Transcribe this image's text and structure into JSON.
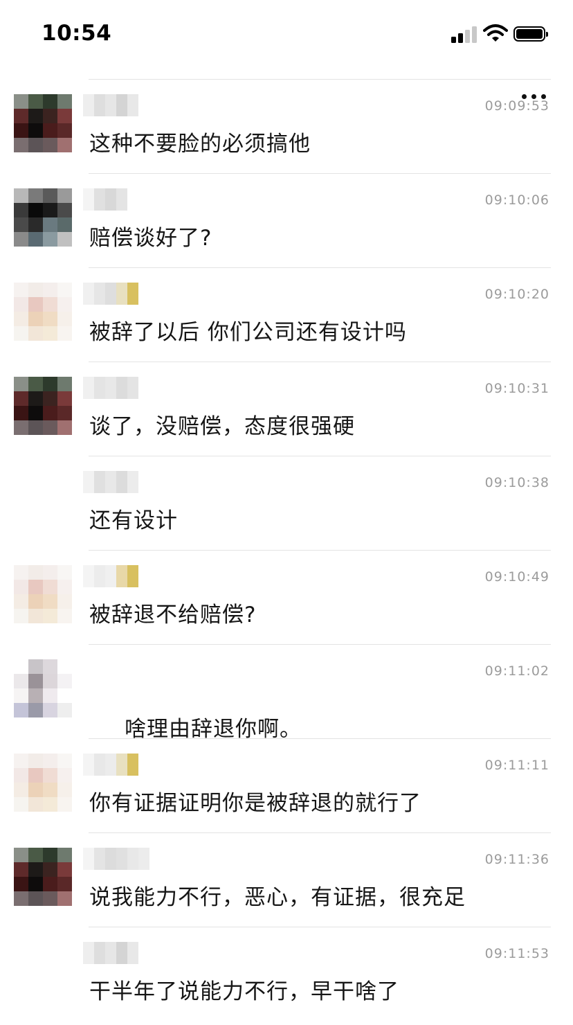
{
  "status": {
    "time": "10:54"
  },
  "icons": {
    "more": "more-dots-icon",
    "signal": "cellular-signal-icon",
    "wifi": "wifi-icon",
    "battery": "battery-icon"
  },
  "messages": [
    {
      "time": "09:09:53",
      "text": "这种不要脸的必须搞他"
    },
    {
      "time": "09:10:06",
      "text": "赔偿谈好了?"
    },
    {
      "time": "09:10:20",
      "text": "被辞了以后 你们公司还有设计吗"
    },
    {
      "time": "09:10:31",
      "text": "谈了，没赔偿，态度很强硬"
    },
    {
      "time": "09:10:38",
      "text": "还有设计"
    },
    {
      "time": "09:10:49",
      "text": "被辞退不给赔偿?"
    },
    {
      "time": "09:11:02",
      "text": "啥理由辞退你啊。"
    },
    {
      "time": "09:11:11",
      "text": "你有证据证明你是被辞退的就行了"
    },
    {
      "time": "09:11:36",
      "text": "说我能力不行，恶心，有证据，很充足"
    },
    {
      "time": "09:11:53",
      "text": "干半年了说能力不行，早干啥了"
    }
  ]
}
